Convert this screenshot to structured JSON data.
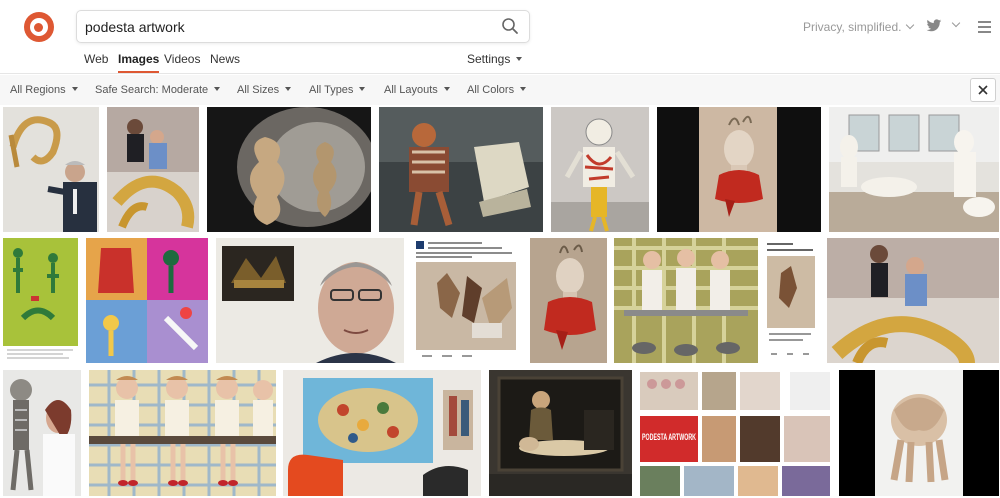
{
  "search": {
    "value": "podesta artwork",
    "placeholder": ""
  },
  "header": {
    "tagline": "Privacy, simplified."
  },
  "nav": {
    "tabs": [
      "Web",
      "Images",
      "Videos",
      "News"
    ],
    "active": "Images",
    "settings": "Settings"
  },
  "filters": [
    "All Regions",
    "Safe Search: Moderate",
    "All Sizes",
    "All Types",
    "All Layouts",
    "All Colors"
  ],
  "icons": {
    "logo": "duckduckgo-logo",
    "search": "search-icon",
    "twitter": "twitter-icon",
    "menu": "hamburger-menu-icon",
    "close": "close-icon"
  },
  "colors": {
    "accent": "#de5833",
    "filter_bar": "#f7f7f7"
  },
  "results": [
    {
      "row": 1,
      "subject": "sculpture with man in suit"
    },
    {
      "row": 1,
      "subject": "people posing with gold sculpture"
    },
    {
      "row": 1,
      "subject": "twisted sculptures in dome"
    },
    {
      "row": 1,
      "subject": "figure sculpture on chair"
    },
    {
      "row": 1,
      "subject": "sculpture figure in red"
    },
    {
      "row": 1,
      "subject": "bust with red cloth"
    },
    {
      "row": 1,
      "subject": "white figures in room"
    },
    {
      "row": 2,
      "subject": "green painting figures"
    },
    {
      "row": 2,
      "subject": "colorful grid paintings"
    },
    {
      "row": 2,
      "subject": "man portrait with painting"
    },
    {
      "row": 2,
      "subject": "tweet with figure image"
    },
    {
      "row": 2,
      "subject": "bust with red cloth"
    },
    {
      "row": 2,
      "subject": "painting three girls"
    },
    {
      "row": 2,
      "subject": "phone screenshot"
    },
    {
      "row": 2,
      "subject": "people posing with gold sculpture"
    },
    {
      "row": 3,
      "subject": "skeleton sculpture"
    },
    {
      "row": 3,
      "subject": "painting girls on bench"
    },
    {
      "row": 3,
      "subject": "room with large painting"
    },
    {
      "row": 3,
      "subject": "dark classical painting"
    },
    {
      "row": 3,
      "subject": "collage podesta artwork"
    },
    {
      "row": 3,
      "subject": "furry creature sculpture"
    }
  ],
  "collage_text": "PODESTA ARTWORK"
}
